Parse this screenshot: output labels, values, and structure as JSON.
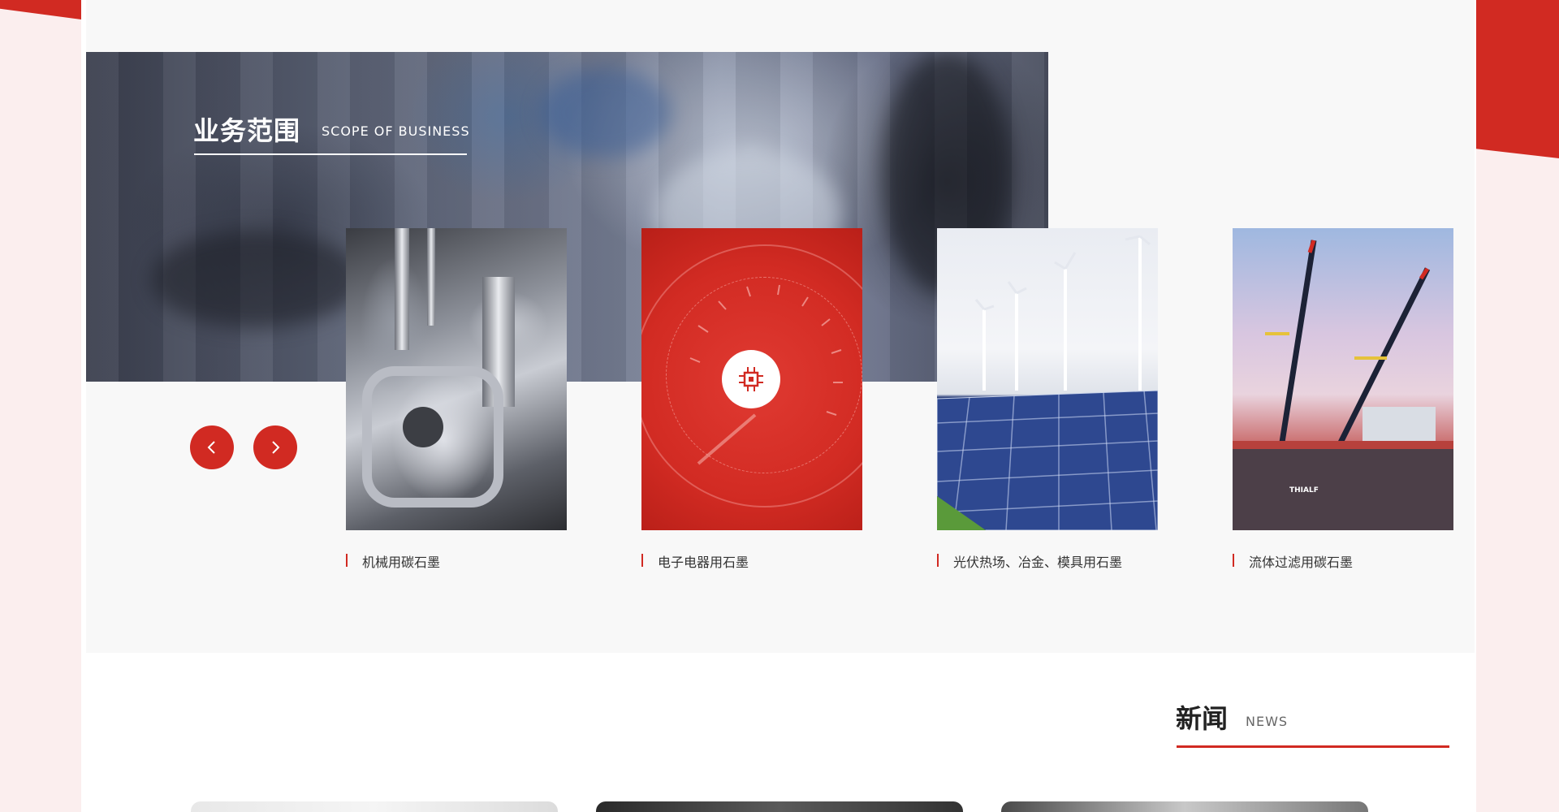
{
  "business": {
    "title": "业务范围",
    "subtitle": "SCOPE OF BUSINESS",
    "prev_label": "‹",
    "next_label": "›",
    "cards": [
      {
        "caption": "机械用碳石墨",
        "image": "machinery-parts"
      },
      {
        "caption": "电子电器用石墨",
        "image": "speedometer-red",
        "icon": "circuit-chip-icon"
      },
      {
        "caption": "光伏热场、冶金、模具用石墨",
        "image": "solar-panels-wind-turbines"
      },
      {
        "caption": "流体过滤用碳石墨",
        "image": "offshore-cranes",
        "image_text": "THIALF"
      }
    ]
  },
  "news": {
    "title": "新闻",
    "subtitle": "NEWS"
  },
  "colors": {
    "accent": "#d12a22",
    "page_bg": "#fbeeee",
    "section_bg": "#f8f8f8"
  }
}
